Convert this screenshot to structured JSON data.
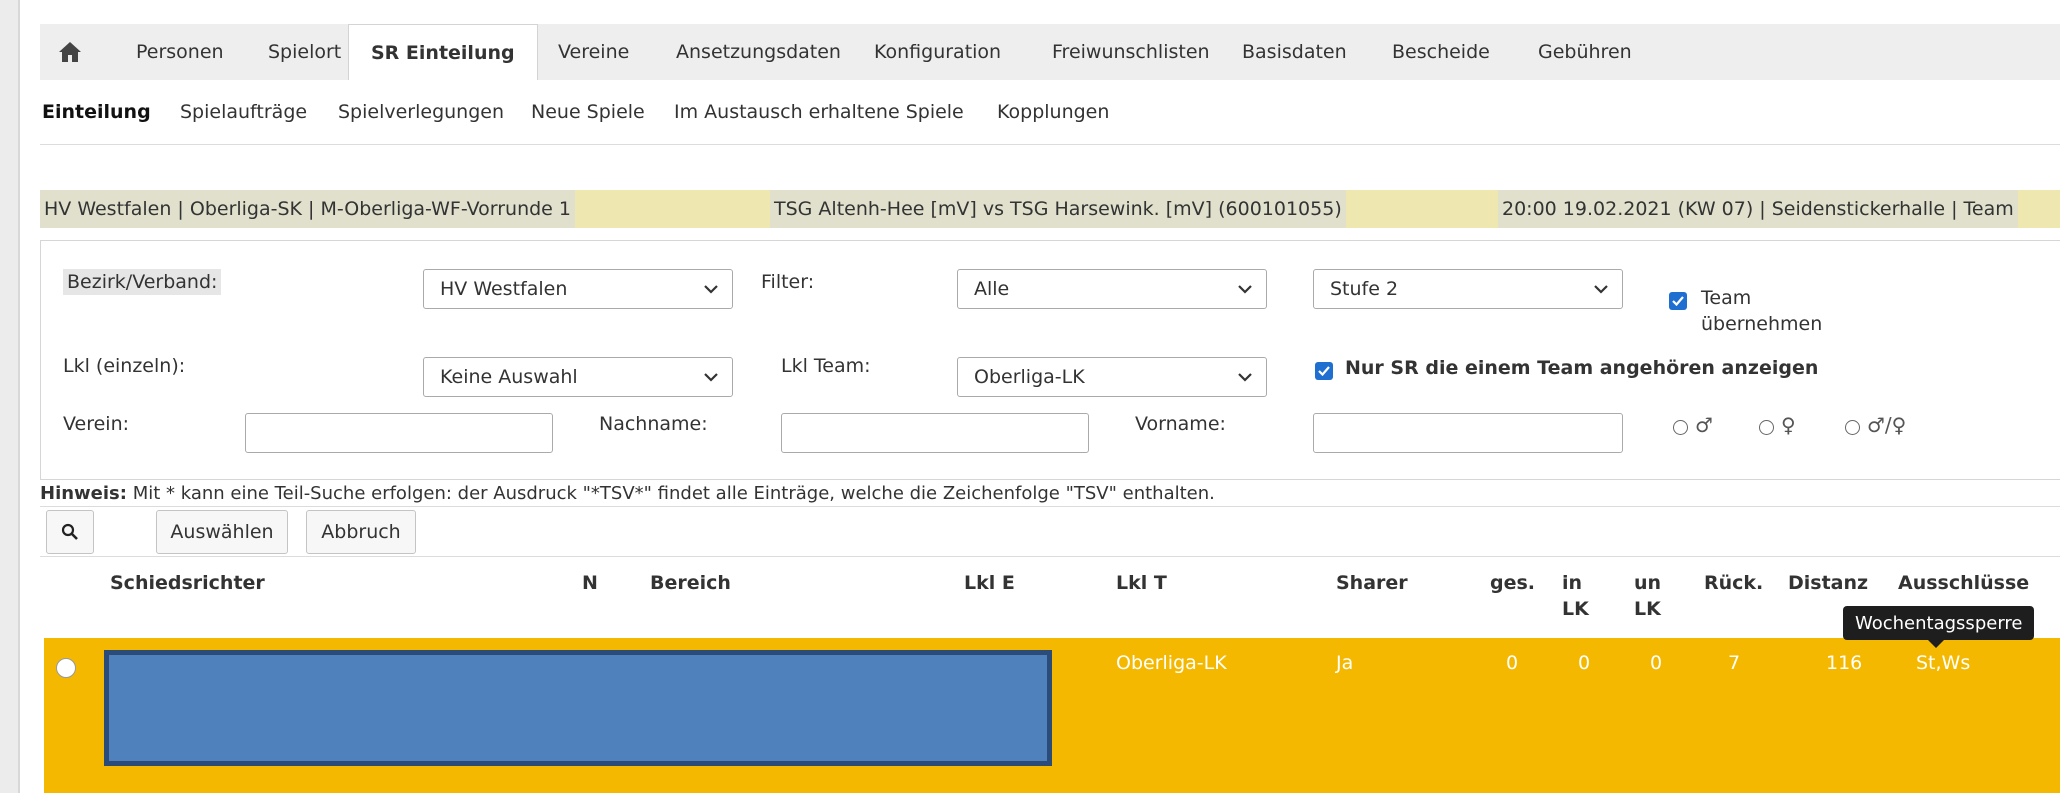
{
  "top_nav": {
    "home_icon": "home-icon",
    "tabs": [
      {
        "label": "Personen"
      },
      {
        "label": "Spielort"
      },
      {
        "label": "SR Einteilung"
      },
      {
        "label": "Vereine"
      },
      {
        "label": "Ansetzungsdaten"
      },
      {
        "label": "Konfiguration"
      },
      {
        "label": "Freiwunschlisten"
      },
      {
        "label": "Basisdaten"
      },
      {
        "label": "Bescheide"
      },
      {
        "label": "Gebühren"
      }
    ],
    "active_tab": "SR Einteilung"
  },
  "sub_nav": {
    "items": [
      {
        "label": "Einteilung"
      },
      {
        "label": "Spielaufträge"
      },
      {
        "label": "Spielverlegungen"
      },
      {
        "label": "Neue Spiele"
      },
      {
        "label": "Im Austausch erhaltene Spiele"
      },
      {
        "label": "Kopplungen"
      }
    ],
    "active_item": "Einteilung"
  },
  "info_bar": {
    "league": "HV Westfalen | Oberliga-SK | M-Oberliga-WF-Vorrunde 1",
    "match": "TSG Altenh-Hee [mV] vs TSG Harsewink. [mV] (600101055)",
    "datetime_venue": "20:00 19.02.2021 (KW 07) | Seidenstickerhalle | Team"
  },
  "filters": {
    "bezirk_label": "Bezirk/Verband:",
    "bezirk_value": "HV Westfalen",
    "filter_label": "Filter:",
    "filter_value": "Alle",
    "stufe_value": "Stufe 2",
    "team_uebernehmen_label": "Team übernehmen",
    "team_uebernehmen_checked": true,
    "lkl_einzeln_label": "Lkl (einzeln):",
    "lkl_einzeln_value": "Keine Auswahl",
    "lkl_team_label": "Lkl Team:",
    "lkl_team_value": "Oberliga-LK",
    "nur_sr_team_label": "Nur SR die einem Team angehören anzeigen",
    "nur_sr_team_checked": true,
    "verein_label": "Verein:",
    "verein_value": "",
    "nachname_label": "Nachname:",
    "nachname_value": "",
    "vorname_label": "Vorname:",
    "vorname_value": "",
    "gender_options": [
      "♂",
      "♀",
      "♂/♀"
    ]
  },
  "hint": {
    "bold": "Hinweis:",
    "text": " Mit * kann eine Teil-Suche erfolgen: der Ausdruck \"*TSV*\" findet alle Einträge, welche die Zeichenfolge \"TSV\" enthalten."
  },
  "toolbar": {
    "search_icon": "search-icon",
    "select_label": "Auswählen",
    "cancel_label": "Abbruch"
  },
  "table": {
    "headers": {
      "schiedsrichter": "Schiedsrichter",
      "n": "N",
      "bereich": "Bereich",
      "lkl_e": "Lkl E",
      "lkl_t": "Lkl T",
      "sharer": "Sharer",
      "ges": "ges.",
      "in_lk_1": "in",
      "in_lk_2": "LK",
      "un_lk_1": "un",
      "un_lk_2": "LK",
      "rueck": "Rück.",
      "distanz": "Distanz",
      "ausschluesse": "Ausschlüsse"
    },
    "rows": [
      {
        "lkl_t": "Oberliga-LK",
        "sharer": "Ja",
        "ges": "0",
        "in_lk": "0",
        "un_lk": "0",
        "rueck": "7",
        "distanz": "116",
        "ausschluesse": "St,Ws",
        "highlight_color": "#f5b800"
      }
    ]
  },
  "tooltip": {
    "text": "Wochentagssperre"
  },
  "colors": {
    "accent_row": "#f5b800",
    "info_bar": "#eee8b0",
    "checkbox": "#1f6fd1",
    "redaction": "#4f81bd"
  }
}
